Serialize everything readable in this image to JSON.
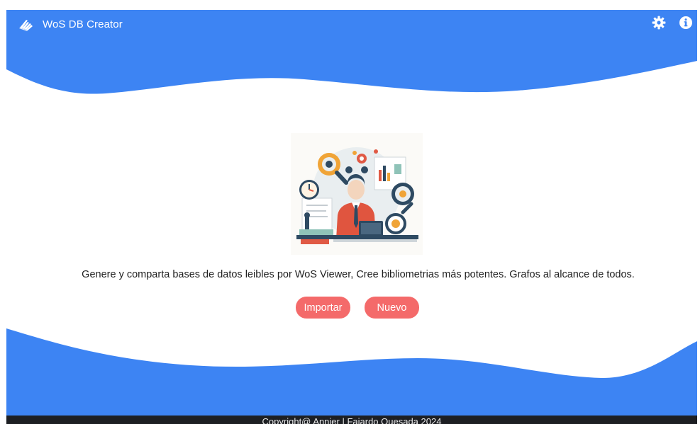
{
  "app": {
    "title": "WoS DB Creator",
    "logo_icon": "book-stack-icon"
  },
  "navbar": {
    "settings_icon": "gear-icon",
    "info_icon": "info-icon"
  },
  "hero": {
    "illustration": "researcher-with-laptop-illustration",
    "tagline": "Genere y comparta bases de datos leibles por WoS Viewer, Cree bibliometrias más potentes. Grafos al alcance de todos."
  },
  "actions": {
    "import_label": "Importar",
    "new_label": "Nuevo"
  },
  "footer": {
    "copyright": "Copyright@ Annier | Fajardo Quesada 2024"
  },
  "colors": {
    "primary": "#3d84f3",
    "button": "#f46a6a",
    "footer": "#1d1f23",
    "background": "#ffffff"
  }
}
